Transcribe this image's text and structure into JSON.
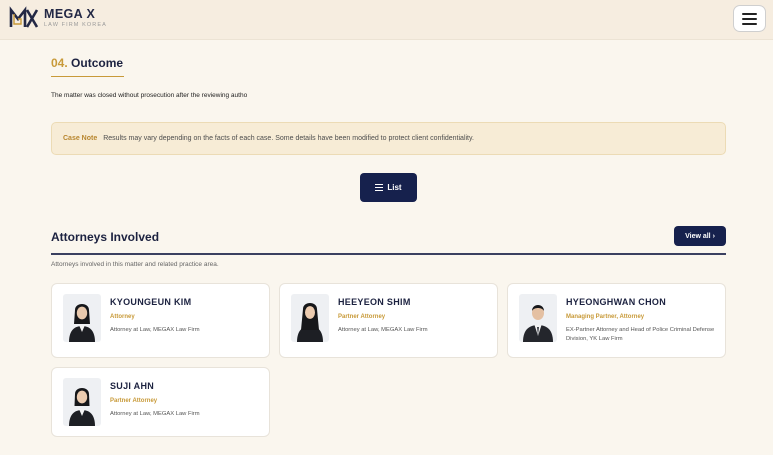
{
  "header": {
    "brand_title": "MEGA X",
    "brand_subtitle": "LAW FIRM KOREA",
    "logo_icon": "megax-logo",
    "menu_icon": "hamburger-menu-icon"
  },
  "outcome": {
    "number": "04.",
    "heading": "Outcome",
    "text": "The matter was closed without prosecution after the reviewing autho"
  },
  "case_note": {
    "label": "Case Note",
    "text": "Results may vary depending on the facts of each case. Some details have been modified to protect client confidentiality."
  },
  "list_button": {
    "label": "List",
    "icon": "list-icon"
  },
  "attorneys": {
    "title": "Attorneys Involved",
    "view_all": "View all ›",
    "subtitle": "Attorneys involved in this matter and related practice area.",
    "items": [
      {
        "name": "KYOUNGEUN KIM",
        "role": "Attorney",
        "desc": "Attorney at Law, MEGAX Law Firm"
      },
      {
        "name": "HEEYEON SHIM",
        "role": "Partner Attorney",
        "desc": "Attorney at Law, MEGAX Law Firm"
      },
      {
        "name": "HYEONGHWAN CHON",
        "role": "Managing Partner, Attorney",
        "desc": "EX-Partner Attorney and Head of Police Criminal Defense Division, YK Law Firm"
      },
      {
        "name": "SUJI AHN",
        "role": "Partner Attorney",
        "desc": "Attorney at Law, MEGAX Law Firm"
      }
    ]
  },
  "colors": {
    "navy": "#16214d",
    "gold": "#c89a39",
    "background": "#faf6ee",
    "note_background": "#f7ecd6"
  }
}
